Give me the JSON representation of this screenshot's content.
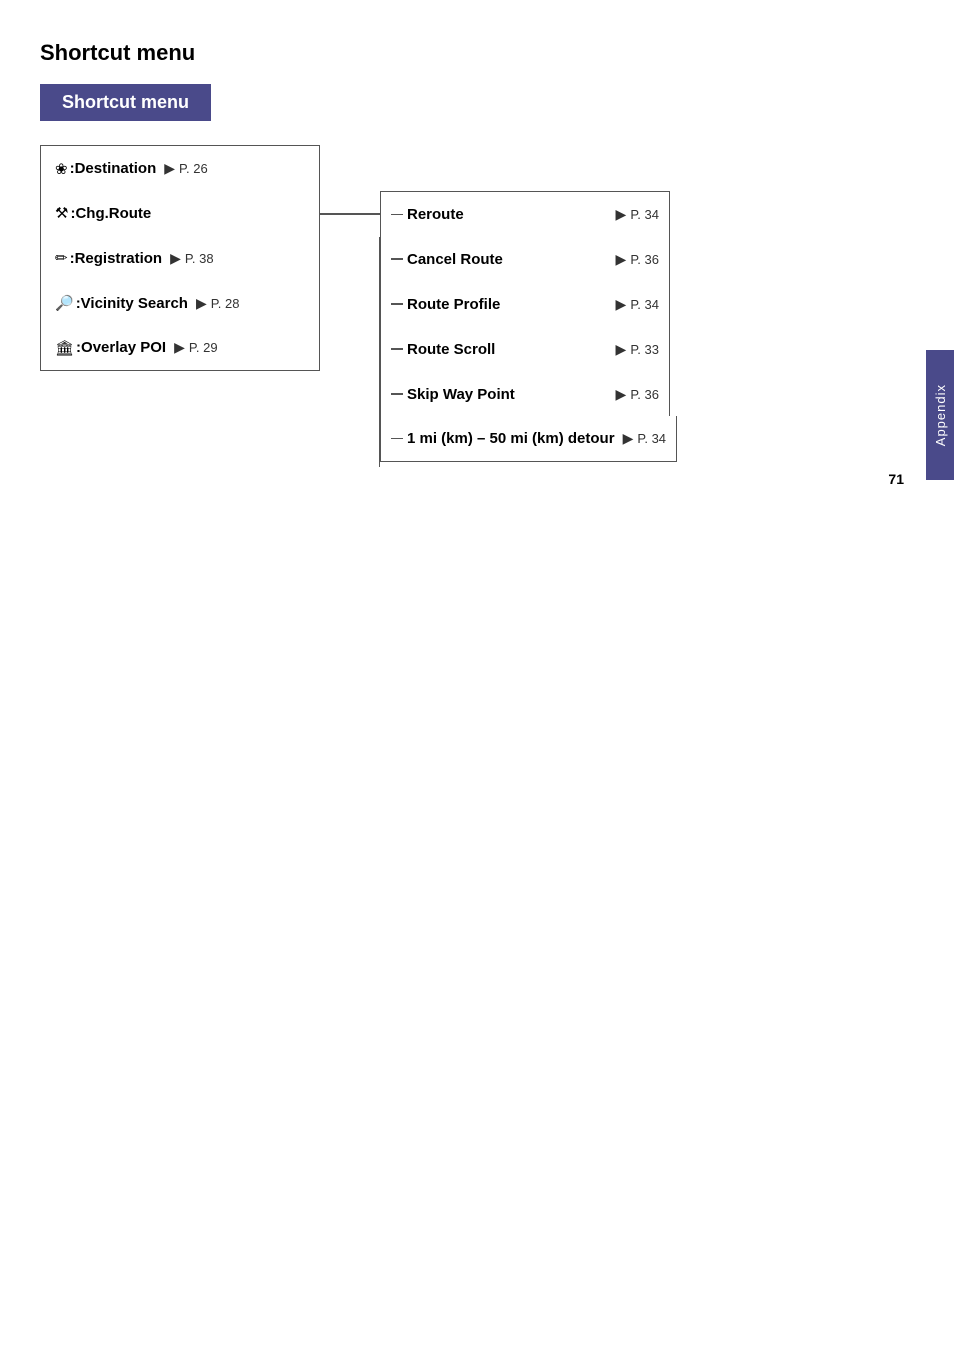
{
  "page": {
    "main_title": "Shortcut menu",
    "shortcut_box_label": "Shortcut menu",
    "page_number": "71",
    "side_tab_label": "Appendix"
  },
  "left_menu": [
    {
      "icon": "🚩",
      "label": ":Destination",
      "has_arrow": true,
      "page_ref": "P. 26",
      "connects_right": false
    },
    {
      "icon": "🔧",
      "label": ":Chg.Route",
      "has_arrow": false,
      "page_ref": "",
      "connects_right": true
    },
    {
      "icon": "📋",
      "label": ":Registration",
      "has_arrow": true,
      "page_ref": "P. 38",
      "connects_right": false
    },
    {
      "icon": "🔍",
      "label": ":Vicinity Search",
      "has_arrow": true,
      "page_ref": "P. 28",
      "connects_right": false
    },
    {
      "icon": "📍",
      "label": ":Overlay POI",
      "has_arrow": true,
      "page_ref": "P. 29",
      "connects_right": false
    }
  ],
  "right_menu": [
    {
      "label": "Reroute",
      "page_ref": "P. 34"
    },
    {
      "label": "Cancel Route",
      "page_ref": "P. 36"
    },
    {
      "label": "Route Profile",
      "page_ref": "P. 34"
    },
    {
      "label": "Route Scroll",
      "page_ref": "P. 33"
    },
    {
      "label": "Skip Way Point",
      "page_ref": "P. 36"
    },
    {
      "label": "1 mi (km) – 50 mi (km) detour",
      "page_ref": "P. 34"
    }
  ],
  "icons": {
    "destination": "❀",
    "chg_route": "⚒",
    "registration": "✏",
    "vicinity": "🔎",
    "overlay": "🏛"
  }
}
